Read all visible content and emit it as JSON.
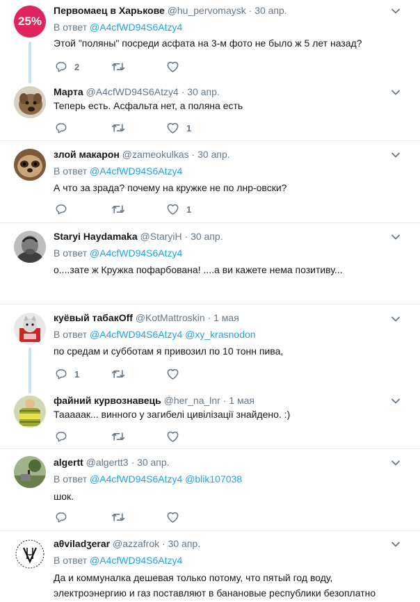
{
  "tweets": [
    {
      "name": "Первомаец в Харькове",
      "handle": "@hu_pervomaysk",
      "time": "30 апр.",
      "avatar_text": "25%",
      "reply_prefix": "В ответ",
      "reply_mentions": "@A4cfWD94S6Atzy4",
      "text": [
        "Этой \"поляны\" посреди асфата на 3-м фото не было ж 5 лет назад?"
      ],
      "reply_count": "2",
      "retweet_count": "",
      "like_count": ""
    },
    {
      "name": "Марта",
      "handle": "@A4cfWD94S6Atzy4",
      "time": "30 апр.",
      "reply_prefix": "",
      "reply_mentions": "",
      "text": [
        "Теперь есть. Асфальта нет, а поляна есть"
      ],
      "reply_count": "",
      "retweet_count": "",
      "like_count": "1"
    },
    {
      "name": "злой макарон",
      "handle": "@zameokulkas",
      "time": "30 апр.",
      "reply_prefix": "В ответ",
      "reply_mentions": "@A4cfWD94S6Atzy4",
      "text": [
        "А что за зрада? почему на кружке не по лнр-овски?"
      ],
      "reply_count": "",
      "retweet_count": "",
      "like_count": "1"
    },
    {
      "name": "Staryi Haydamaka",
      "handle": "@StaryiH",
      "time": "30 апр.",
      "reply_prefix": "В ответ",
      "reply_mentions": "@A4cfWD94S6Atzy4",
      "text": [
        "о....зате ж Кружка пофарбована! ....а ви кажете нема позитиву..."
      ],
      "reply_count": "",
      "retweet_count": "",
      "like_count": ""
    },
    {
      "name": "куёвый табакOff",
      "handle": "@KotMattroskin",
      "time": "1 мая",
      "reply_prefix": "В ответ",
      "reply_mentions": "@A4cfWD94S6Atzy4 @xy_krasnodon",
      "text": [
        "по средам и субботам я привозил по 10 тонн пива,"
      ],
      "reply_count": "1",
      "retweet_count": "",
      "like_count": ""
    },
    {
      "name": "файний курвознавець",
      "handle": "@her_na_lnr",
      "time": "1 мая",
      "reply_prefix": "",
      "reply_mentions": "",
      "text": [
        "Тааааак... винного у загибелі цивілізації знайдено. :)"
      ],
      "reply_count": "",
      "retweet_count": "",
      "like_count": ""
    },
    {
      "name": "algertt",
      "handle": "@algertt3",
      "time": "30 апр.",
      "reply_prefix": "В ответ",
      "reply_mentions": "@A4cfWD94S6Atzy4 @blik107038",
      "text": [
        "шок."
      ],
      "reply_count": "",
      "retweet_count": "",
      "like_count": ""
    },
    {
      "name": "aθviladʒerar",
      "handle": "@azzafrok",
      "time": "30 апр.",
      "reply_prefix": "В ответ",
      "reply_mentions": "@A4cfWD94S6Atzy4",
      "text": [
        "Да и коммуналка дешевая только потому, что  пятый год воду,",
        "электроэнергию и газ поставляют в банановые республики безоплатно"
      ],
      "reply_count": "",
      "retweet_count": "",
      "like_count": ""
    }
  ],
  "colors": {
    "link": "#1da1f2",
    "muted": "#657786",
    "thread": "#c4e3f8",
    "badge": "#e0245e"
  },
  "icons": {
    "reply": "reply-icon",
    "retweet": "retweet-icon",
    "like": "heart-icon",
    "menu": "chevron-down-icon"
  }
}
